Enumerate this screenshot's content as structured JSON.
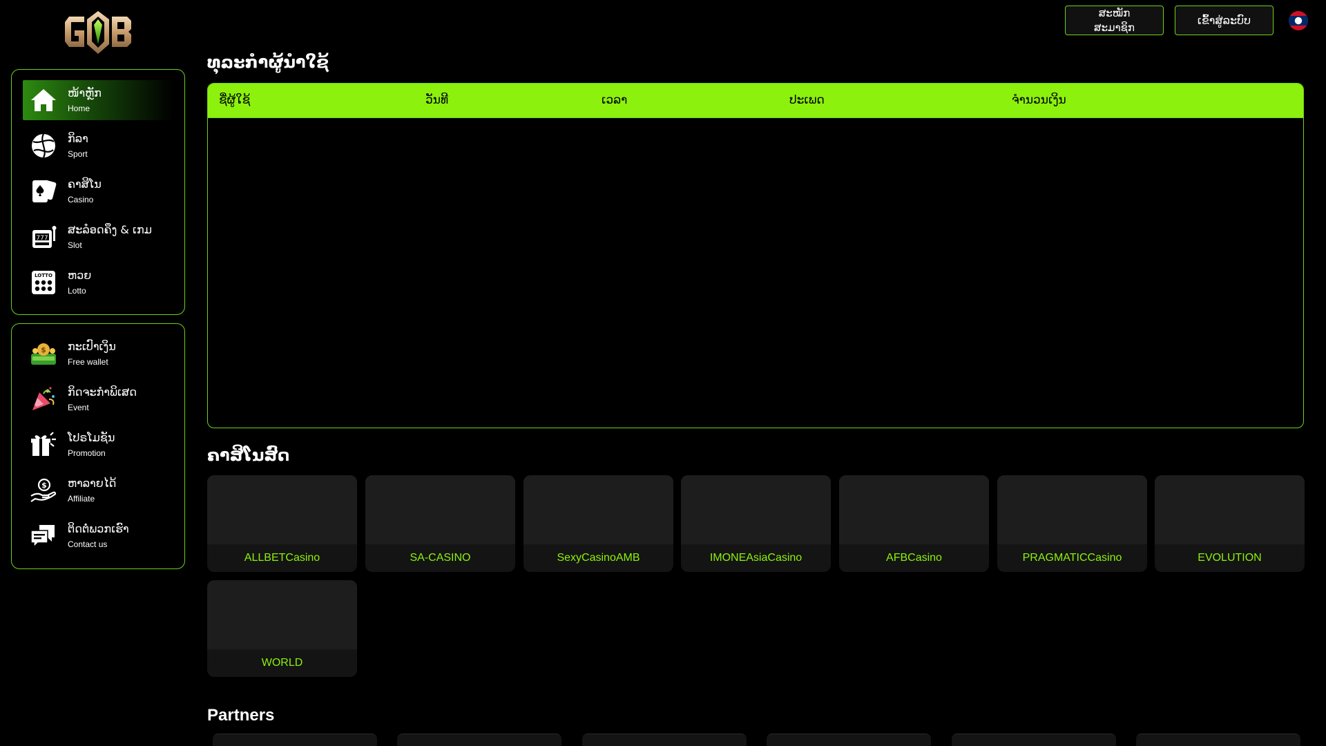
{
  "brand": {
    "logo_text": "GOB"
  },
  "header": {
    "register_label": "ສະໝັກ\nສະມາຊິກ",
    "login_label": "ເຂົ້າສູ່ລະບົບ",
    "language_flag": "lao-flag"
  },
  "sidebar": {
    "main": [
      {
        "lao": "ໜ້າຫຼັກ",
        "en": "Home",
        "icon": "home-icon",
        "active": true
      },
      {
        "lao": "ກິລາ",
        "en": "Sport",
        "icon": "ball-icon"
      },
      {
        "lao": "ຄາສິໂນ",
        "en": "Casino",
        "icon": "cards-icon"
      },
      {
        "lao": "ສະລ໋ອດຄຶງ & ເກມ",
        "en": "Slot",
        "icon": "slot-machine-icon"
      },
      {
        "lao": "ຫວຍ",
        "en": "Lotto",
        "icon": "lotto-icon"
      }
    ],
    "extra": [
      {
        "lao": "ກະເປົາເງິນ",
        "en": "Free wallet",
        "icon": "wallet-icon"
      },
      {
        "lao": "ກິດຈະກຳພິເສດ",
        "en": "Event",
        "icon": "party-popper-icon"
      },
      {
        "lao": "ໂປຣໂມຊັນ",
        "en": "Promotion",
        "icon": "gift-icon"
      },
      {
        "lao": "ຫາລາຍໄດ້",
        "en": "Affiliate",
        "icon": "money-hand-icon"
      },
      {
        "lao": "ຕິດຕໍ່ພວກເຮົາ",
        "en": "Contact us",
        "icon": "chat-icon"
      }
    ]
  },
  "transactions": {
    "title": "ທຸລະກຳຜູ້ນຳໃຊ້",
    "columns": [
      "ຊື່ຜູ້ໃຊ້",
      "ວັນທີ",
      "ເວລາ",
      "ປະເພດ",
      "ຈຳນວນເງິນ"
    ],
    "rows": []
  },
  "live_casino": {
    "title": "ຄາສິໂນສົດ",
    "games": [
      "ALLBETCasino",
      "SA-CASINO",
      "SexyCasinoAMB",
      "IMONEAsiaCasino",
      "AFBCasino",
      "PRAGMATICCasino",
      "EVOLUTION",
      "WORLD"
    ]
  },
  "partners": {
    "title": "Partners",
    "count": 6
  },
  "colors": {
    "accent": "#8cf10d",
    "border": "#6fd21a",
    "card": "#141414"
  }
}
